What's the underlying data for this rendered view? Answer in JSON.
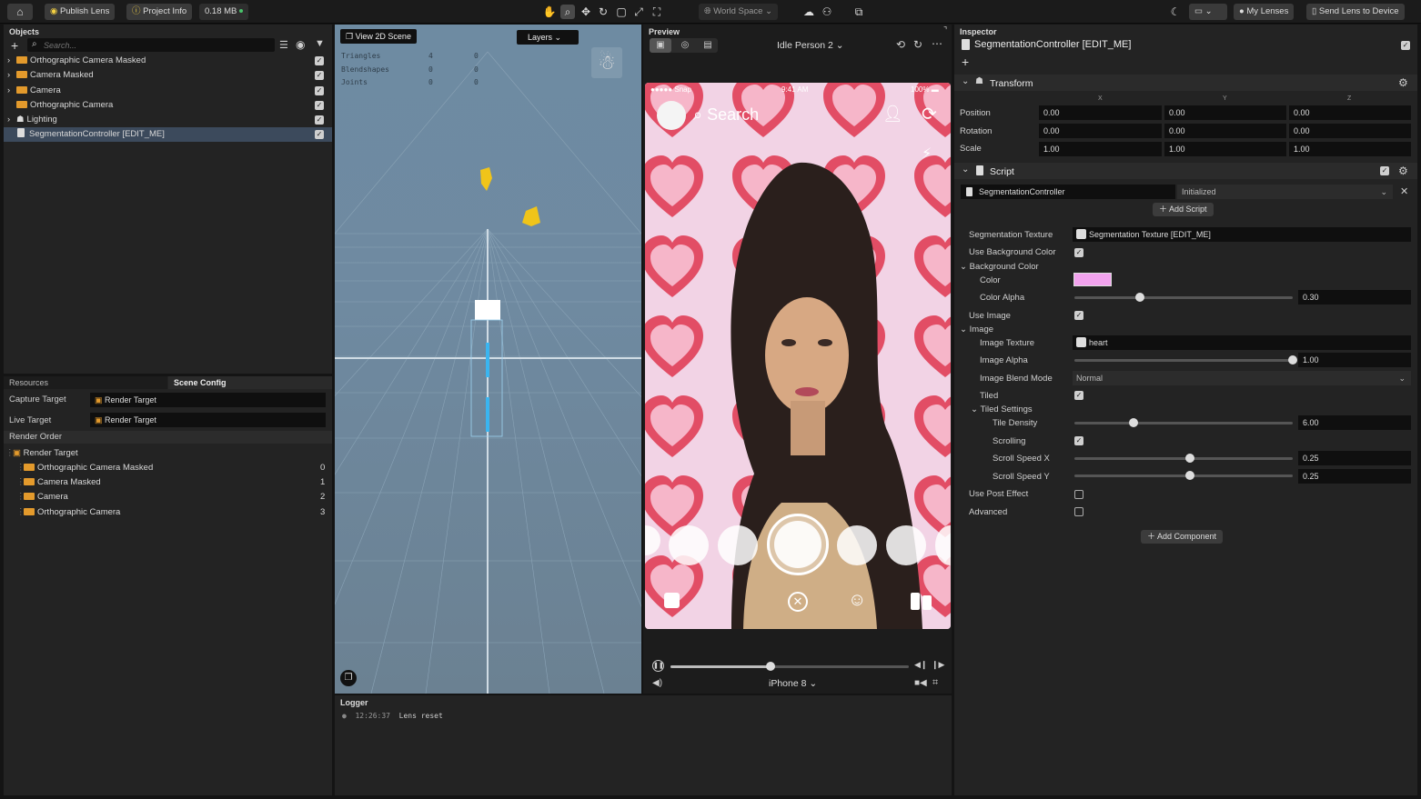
{
  "toolbar": {
    "publish_label": "Publish Lens",
    "project_info_label": "Project Info",
    "size_label": "0.18 MB",
    "space_label": "World Space",
    "my_lenses_label": "My Lenses",
    "send_label": "Send Lens to Device"
  },
  "objects": {
    "title": "Objects",
    "search_placeholder": "Search...",
    "items": [
      {
        "label": "Orthographic Camera Masked"
      },
      {
        "label": "Camera Masked"
      },
      {
        "label": "Camera"
      },
      {
        "label": "Orthographic Camera"
      },
      {
        "label": "Lighting"
      },
      {
        "label": "SegmentationController [EDIT_ME]"
      }
    ]
  },
  "resources": {
    "tab_resources": "Resources",
    "tab_scene_config": "Scene Config",
    "capture_target_label": "Capture Target",
    "capture_target_value": "Render Target",
    "live_target_label": "Live Target",
    "live_target_value": "Render Target",
    "render_order_label": "Render Order",
    "render_target_label": "Render Target",
    "order_items": [
      {
        "label": "Orthographic Camera Masked",
        "index": "0"
      },
      {
        "label": "Camera Masked",
        "index": "1"
      },
      {
        "label": "Camera",
        "index": "2"
      },
      {
        "label": "Orthographic Camera",
        "index": "3"
      }
    ]
  },
  "scene": {
    "view_label": "View 2D Scene",
    "layers_label": "Layers",
    "stats": [
      {
        "name": "Triangles",
        "a": "4",
        "b": "0"
      },
      {
        "name": "Blendshapes",
        "a": "0",
        "b": "0"
      },
      {
        "name": "Joints",
        "a": "0",
        "b": "0"
      }
    ]
  },
  "preview": {
    "title": "Preview",
    "person_label": "Idle Person 2",
    "device_label": "iPhone 8",
    "carrier": "Snap",
    "time": "9:41 AM",
    "battery": "100%",
    "search_text": "Search",
    "playback_progress": 0.42
  },
  "logger": {
    "title": "Logger",
    "entries": [
      {
        "time": "12:26:37",
        "message": "Lens reset"
      }
    ]
  },
  "inspector": {
    "title": "Inspector",
    "object_name": "SegmentationController [EDIT_ME]",
    "transform": {
      "title": "Transform",
      "axis_x": "X",
      "axis_y": "Y",
      "axis_z": "Z",
      "position_label": "Position",
      "rotation_label": "Rotation",
      "scale_label": "Scale",
      "position": [
        "0.00",
        "0.00",
        "0.00"
      ],
      "rotation": [
        "0.00",
        "0.00",
        "0.00"
      ],
      "scale": [
        "1.00",
        "1.00",
        "1.00"
      ]
    },
    "script": {
      "title": "Script",
      "name": "SegmentationController",
      "event": "Initialized",
      "add_script_label": "Add Script"
    },
    "props": {
      "segmentation_texture_label": "Segmentation Texture",
      "segmentation_texture_value": "Segmentation Texture [EDIT_ME]",
      "use_bg_color_label": "Use Background Color",
      "bg_color_label": "Background Color",
      "color_label": "Color",
      "color_value": "#f2a3ee",
      "color_alpha_label": "Color Alpha",
      "color_alpha_value": "0.30",
      "use_image_label": "Use Image",
      "image_label": "Image",
      "image_texture_label": "Image Texture",
      "image_texture_value": "heart",
      "image_alpha_label": "Image Alpha",
      "image_alpha_value": "1.00",
      "blend_mode_label": "Image Blend Mode",
      "blend_mode_value": "Normal",
      "tiled_label": "Tiled",
      "tiled_settings_label": "Tiled Settings",
      "tile_density_label": "Tile Density",
      "tile_density_value": "6.00",
      "scrolling_label": "Scrolling",
      "scroll_x_label": "Scroll Speed X",
      "scroll_x_value": "0.25",
      "scroll_y_label": "Scroll Speed Y",
      "scroll_y_value": "0.25",
      "use_post_effect_label": "Use Post Effect",
      "advanced_label": "Advanced",
      "add_component_label": "Add Component"
    }
  }
}
